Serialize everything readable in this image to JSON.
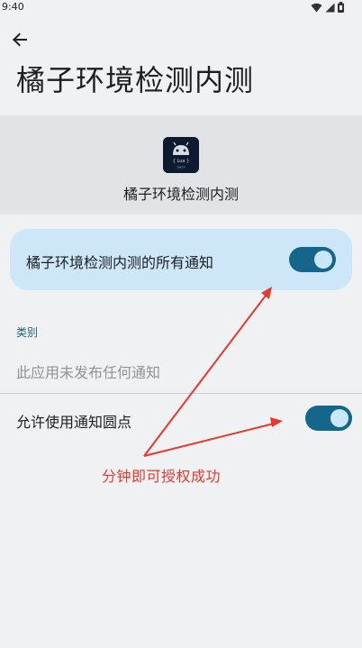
{
  "status_bar": {
    "time": "9:40",
    "icons": [
      "wifi-icon",
      "signal-icon",
      "battery-icon"
    ]
  },
  "header": {
    "back_icon": "arrow-back-icon",
    "title": "橘子环境检测内测"
  },
  "app_info": {
    "icon_text": "{ Lua }",
    "icon_subtext": "TMTY",
    "name": "橘子环境检测内测"
  },
  "all_notifications": {
    "label": "橘子环境检测内测的所有通知",
    "enabled": true
  },
  "categories": {
    "section_label": "类别",
    "empty_text": "此应用未发布任何通知"
  },
  "notification_dot": {
    "label": "允许使用通知圆点",
    "enabled": true
  },
  "annotation": {
    "text": "分钟即可授权成功",
    "color": "#e8382f"
  },
  "colors": {
    "background": "#eff1f3",
    "toggle_track": "#14668a",
    "toggle_knob": "#c9e7f7",
    "card": "#cde6f8",
    "section_label": "#1d6283"
  }
}
